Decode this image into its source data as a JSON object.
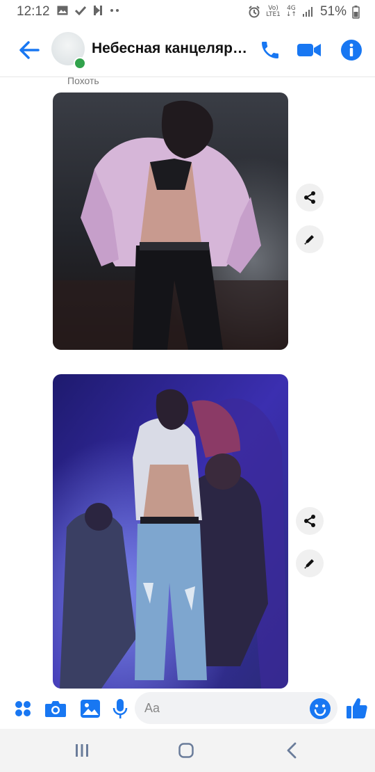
{
  "status_bar": {
    "time": "12:12",
    "network_top": "Vo)",
    "network_bottom": "LTE1",
    "signal_type": "4G",
    "battery": "51%"
  },
  "header": {
    "title": "Небесная канцеляр…",
    "icons": [
      "back-arrow-icon",
      "phone-icon",
      "video-camera-icon",
      "info-icon"
    ]
  },
  "conversation": {
    "sender_name": "Похоть"
  },
  "composer": {
    "placeholder": "Aa",
    "icons": [
      "apps-grid-icon",
      "camera-icon",
      "gallery-icon",
      "microphone-icon",
      "emoji-icon",
      "thumbs-up-icon"
    ]
  },
  "colors": {
    "accent": "#1877f2",
    "presence": "#31a24c"
  }
}
